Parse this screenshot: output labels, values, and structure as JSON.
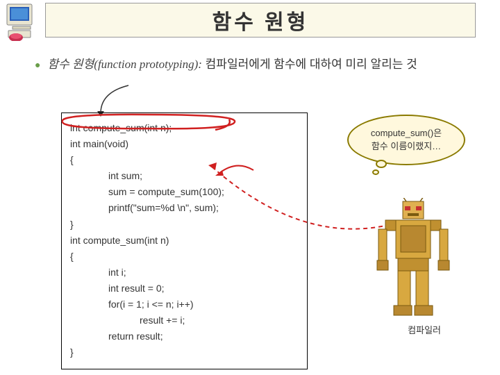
{
  "title": "함수 원형",
  "bullet": {
    "term": "함수 원형(function prototyping):",
    "rest": " 컴파일러에게 함수에 대하여 미리 알리는 것"
  },
  "code": {
    "l1": "int compute_sum(int n);",
    "l2": "int main(void)",
    "l3": "{",
    "l4": "int sum;",
    "l5": "sum = compute_sum(100);",
    "l6": "printf(\"sum=%d \\n\", sum);",
    "l7": "}",
    "l8": "int compute_sum(int n)",
    "l9": "{",
    "l10": "int i;",
    "l11": "int result = 0;",
    "l12": "for(i = 1; i <= n; i++)",
    "l13": "result += i;",
    "l14": "return result;",
    "l15": "}"
  },
  "bubble": {
    "line1": "compute_sum()은",
    "line2": "함수 이름이랬지…"
  },
  "robot_label": "컴파일러"
}
